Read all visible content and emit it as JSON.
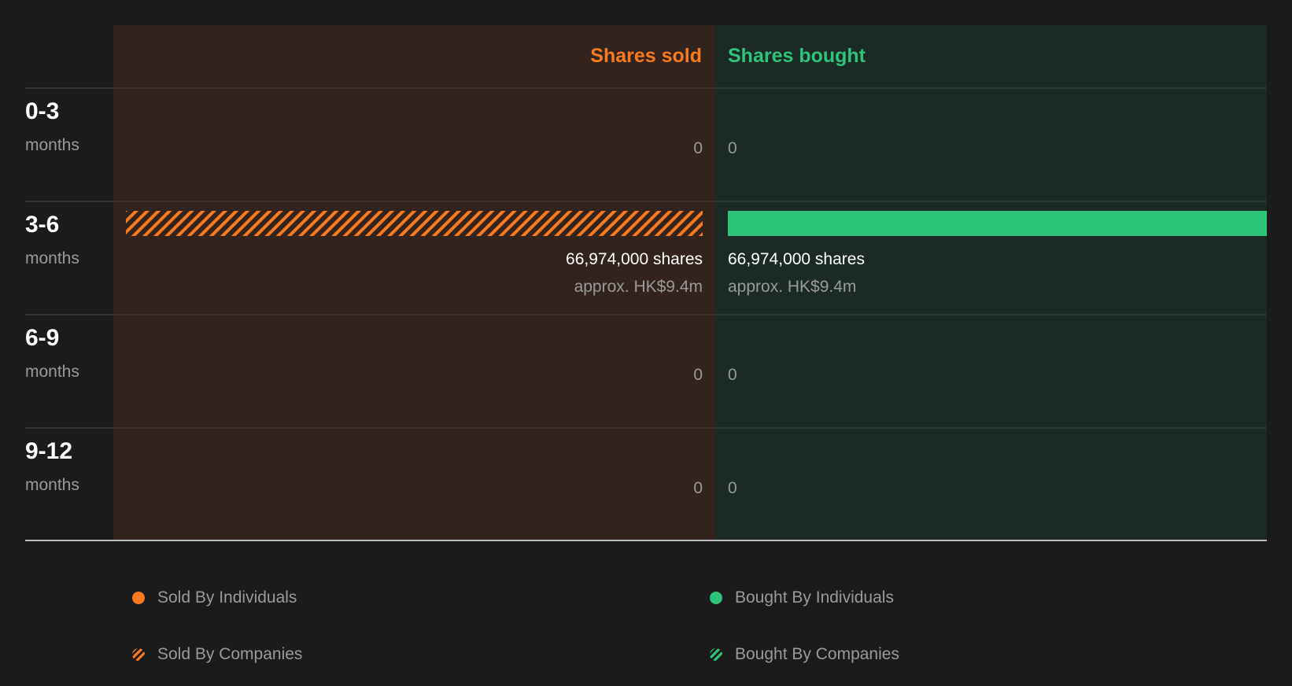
{
  "colors": {
    "sold": "#f97a1f",
    "bought": "#2cc57a",
    "sold_bg": "#32241c",
    "bought_bg": "#1b2a25"
  },
  "chart_data": {
    "type": "bar",
    "title": "",
    "headers": {
      "sold": "Shares sold",
      "bought": "Shares bought"
    },
    "categories": [
      {
        "label": "0-3",
        "sub": "months"
      },
      {
        "label": "3-6",
        "sub": "months"
      },
      {
        "label": "6-9",
        "sub": "months"
      },
      {
        "label": "9-12",
        "sub": "months"
      }
    ],
    "series": [
      {
        "name": "Shares sold",
        "values": [
          0,
          66974000,
          0,
          0
        ],
        "value_labels": [
          "0",
          "66,974,000 shares",
          "0",
          "0"
        ],
        "approx_labels": [
          "",
          "approx. HK$9.4m",
          "",
          ""
        ],
        "fill": [
          "none",
          "companies",
          "none",
          "none"
        ]
      },
      {
        "name": "Shares bought",
        "values": [
          0,
          66974000,
          0,
          0
        ],
        "value_labels": [
          "0",
          "66,974,000 shares",
          "0",
          "0"
        ],
        "approx_labels": [
          "",
          "approx. HK$9.4m",
          "",
          ""
        ],
        "fill": [
          "none",
          "individuals",
          "none",
          "none"
        ]
      }
    ],
    "xlim": [
      0,
      66974000
    ],
    "legend": {
      "placement": "bottom",
      "items": [
        {
          "label": "Sold By Individuals",
          "style": "dot-sold"
        },
        {
          "label": "Bought By Individuals",
          "style": "dot-bought"
        },
        {
          "label": "Sold By Companies",
          "style": "hatch-sold"
        },
        {
          "label": "Bought By Companies",
          "style": "hatch-bought"
        }
      ]
    }
  }
}
